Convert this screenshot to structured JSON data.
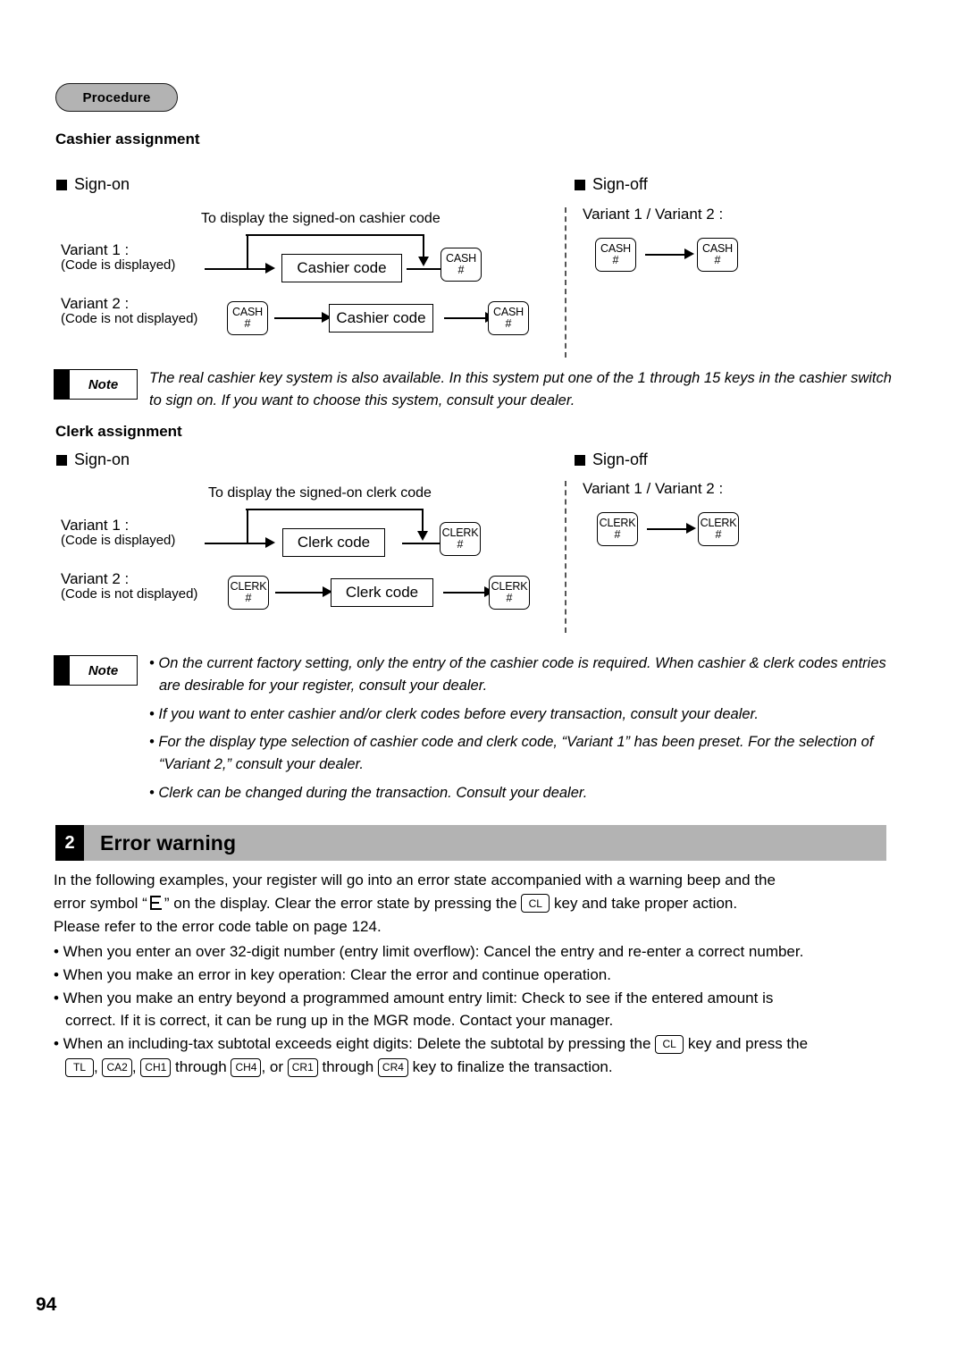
{
  "document": {
    "page_number": "94",
    "procedure_badge": "Procedure"
  },
  "cashier": {
    "heading": "Cashier assignment",
    "signon_label": "Sign-on",
    "signoff_label": "Sign-off",
    "caption": "To display the signed-on cashier code",
    "variant1_title": "Variant 1 :",
    "variant1_sub": "(Code is displayed)",
    "variant2_title": "Variant 2 :",
    "variant2_sub": "(Code is not displayed)",
    "code_box": "Cashier code",
    "key_line1": "CASH",
    "key_line2": "#",
    "signoff_variants": "Variant 1 / Variant 2 :"
  },
  "note1": {
    "badge": "Note",
    "text": "The real cashier key system is also available. In this system put one of the 1 through 15 keys in the cashier switch to sign on. If you want to choose this system, consult your dealer."
  },
  "clerk": {
    "heading": "Clerk assignment",
    "signon_label": "Sign-on",
    "signoff_label": "Sign-off",
    "caption": "To display the signed-on clerk code",
    "variant1_title": "Variant 1 :",
    "variant1_sub": "(Code is displayed)",
    "variant2_title": "Variant 2 :",
    "variant2_sub": "(Code is not displayed)",
    "code_box": "Clerk code",
    "key_line1": "CLERK",
    "key_line2": "#",
    "signoff_variants": "Variant 1 / Variant 2 :"
  },
  "note2": {
    "badge": "Note",
    "bullets": [
      "• On the current factory setting, only the entry of the cashier code is required. When cashier & clerk codes entries are desirable for your register, consult your dealer.",
      "• If you want to enter cashier and/or clerk codes before every transaction, consult your dealer.",
      "• For the display type selection of cashier code and clerk code, “Variant 1” has been preset. For the selection of “Variant 2,” consult your dealer.",
      "• Clerk can be changed during the transaction. Consult your dealer."
    ]
  },
  "section2": {
    "number": "2",
    "title": "Error warning",
    "intro_line1": "In the following examples, your register will go into an error state accompanied with a warning beep and the",
    "intro_line2_a": "error symbol “",
    "intro_line2_b": "” on the display.  Clear the error state by pressing the",
    "intro_line2_key": "CL",
    "intro_line2_c": "key and take proper action.",
    "intro_line3": "Please refer to the error code table on page 124.",
    "bullet1": "• When you enter an over 32-digit number (entry limit overflow): Cancel the entry and re-enter a correct number.",
    "bullet2": "• When you make an error in key operation: Clear the error and continue operation.",
    "bullet3_l1": "• When you make an entry beyond a programmed amount entry limit: Check to see if the entered amount is",
    "bullet3_l2": "correct.  If it is correct, it can be rung up in the MGR mode.  Contact your manager.",
    "bullet4_l1_a": "• When an including-tax subtotal exceeds eight digits: Delete the subtotal by pressing the",
    "bullet4_l1_key": "CL",
    "bullet4_l1_b": "key and press the",
    "bullet4_keys": [
      "TL",
      "CA2",
      "CH1",
      "CH4",
      "CR1",
      "CR4"
    ],
    "bullet4_sep1": ",",
    "bullet4_sep2": ",",
    "bullet4_through1": "through",
    "bullet4_or": ", or",
    "bullet4_through2": "through",
    "bullet4_tail": "key to finalize the transaction."
  }
}
